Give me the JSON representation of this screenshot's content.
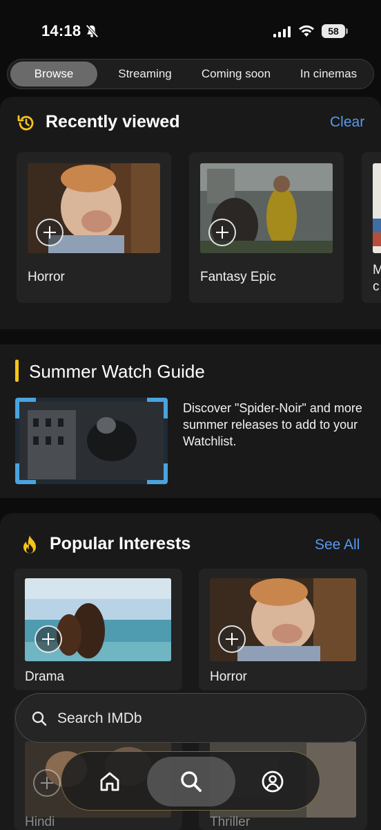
{
  "status": {
    "time": "14:18",
    "battery": "58"
  },
  "tabs": [
    {
      "label": "Browse",
      "active": true
    },
    {
      "label": "Streaming"
    },
    {
      "label": "Coming soon"
    },
    {
      "label": "In cinemas"
    }
  ],
  "recently_viewed": {
    "title": "Recently viewed",
    "action": "Clear",
    "cards": [
      {
        "label": "Horror"
      },
      {
        "label": "Fantasy Epic"
      },
      {
        "label_line1": "M",
        "label_line2": "c"
      }
    ]
  },
  "guide": {
    "title": "Summer Watch Guide",
    "text": "Discover \"Spider-Noir\" and more summer releases to add to your Watchlist."
  },
  "popular": {
    "title": "Popular Interests",
    "action": "See All",
    "cards": [
      {
        "label": "Drama"
      },
      {
        "label": "Horror"
      },
      {
        "label": "Hindi"
      },
      {
        "label": "Thriller"
      }
    ]
  },
  "search": {
    "placeholder": "Search IMDb"
  },
  "colors": {
    "accent_link": "#5799ef",
    "imdb_yellow": "#f5c518"
  },
  "icons": [
    "bell-slash-icon",
    "signal-icon",
    "wifi-icon",
    "history-icon",
    "flame-icon",
    "search-icon",
    "home-icon",
    "user-icon",
    "plus-icon"
  ]
}
